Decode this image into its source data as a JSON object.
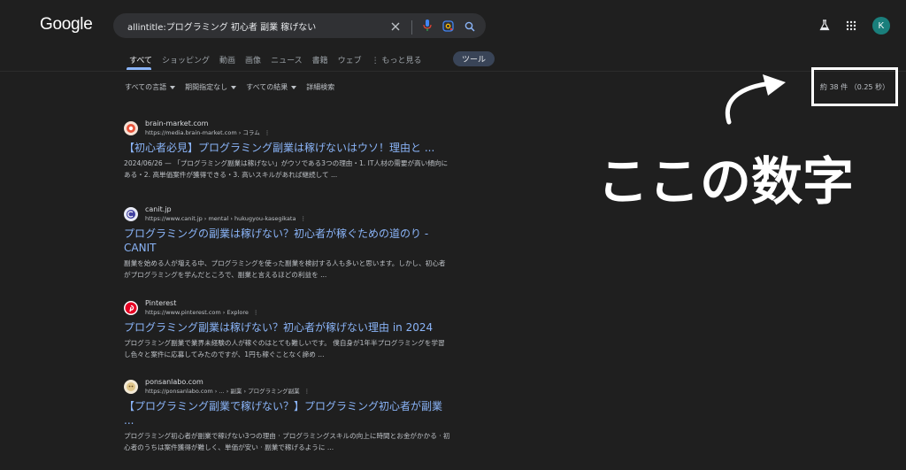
{
  "header": {
    "logo": "Google",
    "search_value": "allintitle:プログラミング 初心者 副業 稼げない",
    "avatar_letter": "K"
  },
  "tabs": [
    {
      "label": "すべて"
    },
    {
      "label": "ショッピング"
    },
    {
      "label": "動画"
    },
    {
      "label": "画像"
    },
    {
      "label": "ニュース"
    },
    {
      "label": "書籍"
    },
    {
      "label": "ウェブ"
    },
    {
      "label": "もっと見る"
    }
  ],
  "tools_label": "ツール",
  "filters": [
    {
      "label": "すべての言語"
    },
    {
      "label": "期間指定なし"
    },
    {
      "label": "すべての結果"
    },
    {
      "label": "詳細検索"
    }
  ],
  "result_stats": "約 38 件 （0.25 秒）",
  "annotation": "ここの数字",
  "results": [
    {
      "site": "brain-market.com",
      "url": "https://media.brain-market.com › コラム",
      "title": "【初心者必見】プログラミング副業は稼げないはウソ！理由と ...",
      "snippet": "2024/06/26 — 「プログラミング副業は稼げない」がウソである3つの理由・1. IT人材の需要が高い傾向にある・2. 高単価案件が獲得できる・3. 高いスキルがあれば継続して ..."
    },
    {
      "site": "canit.jp",
      "url": "https://www.canit.jp › mental › hukugyou-kasegikata",
      "title": "プログラミングの副業は稼げない？初心者が稼ぐための道のり - CANIT",
      "snippet": "副業を始める人が増える中、プログラミングを使った副業を検討する人も多いと思います。しかし、初心者がプログラミングを学んだところで、副業と言えるほどの利益を ..."
    },
    {
      "site": "Pinterest",
      "url": "https://www.pinterest.com › Explore",
      "title": "プログラミング副業は稼げない？初心者が稼げない理由 in 2024",
      "snippet": "プログラミング副業で業界未経験の人が稼ぐのはとても難しいです。 僕自身が1年半プログラミングを学習し色々と案件に応募してみたのですが、1円も稼ぐことなく諦め ..."
    },
    {
      "site": "ponsanlabo.com",
      "url": "https://ponsanlabo.com › ... › 副業 › プログラミング副業",
      "title": "【プログラミング副業で稼げない？】プログラミング初心者が副業 ...",
      "snippet": "プログラミング初心者が副業で稼げない3つの理由 · プログラミングスキルの向上に時間とお金がかかる · 初心者のうちは案件獲得が難しく、単価が安い · 副業で稼げるように ..."
    }
  ],
  "colors": {
    "background": "#1f1f1f",
    "link": "#8ab4f8",
    "text": "#bdc1c6",
    "accent_tab": "#8ab4f8"
  }
}
